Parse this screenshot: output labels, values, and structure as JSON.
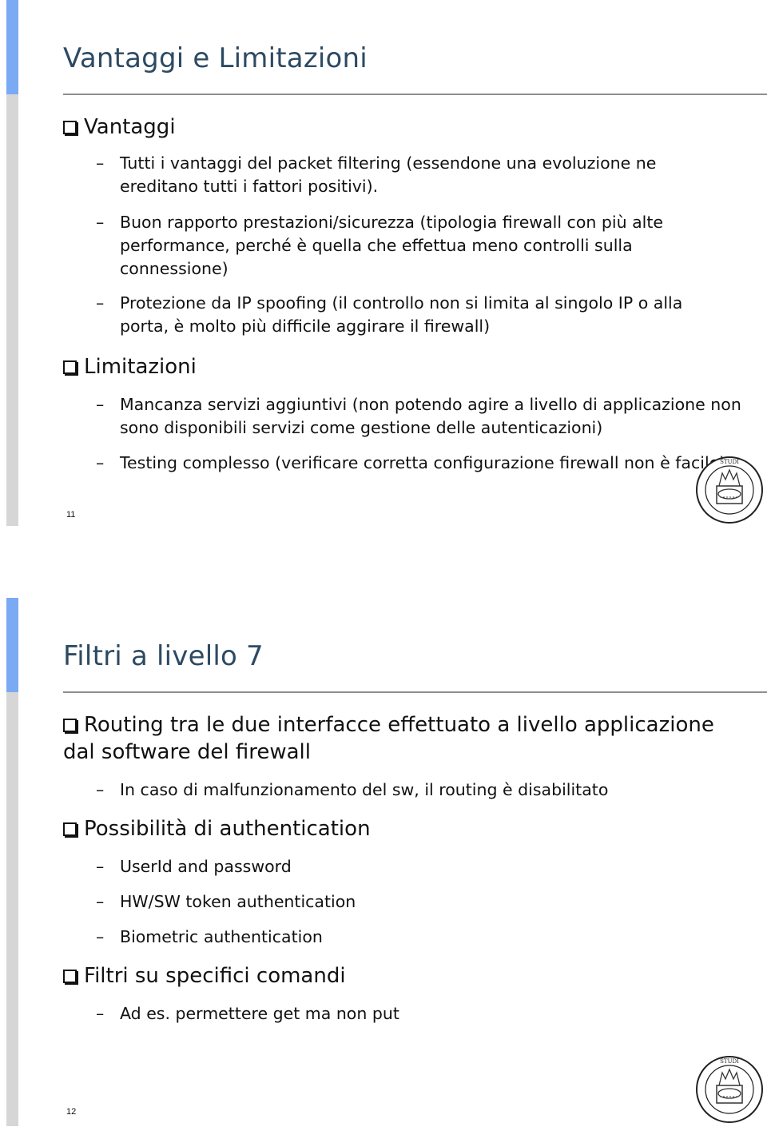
{
  "slides": [
    {
      "title": "Vantaggi e Limitazioni",
      "page_number": "11",
      "sections": [
        {
          "heading": "Vantaggi",
          "items": [
            "Tutti i vantaggi del packet filtering (essendone una evoluzione ne ereditano tutti i fattori positivi).",
            "Buon rapporto prestazioni/sicurezza (tipologia firewall con più alte performance, perché è quella che effettua meno controlli sulla connessione)",
            "Protezione da IP spoofing (il controllo non si limita al singolo IP o alla porta, è molto più difficile aggirare il firewall)"
          ]
        },
        {
          "heading": "Limitazioni",
          "items": [
            "Mancanza servizi aggiuntivi (non potendo agire a livello di applicazione non sono disponibili servizi come gestione delle autenticazioni)",
            "Testing complesso (verificare corretta configurazione firewall non è facile)"
          ]
        }
      ],
      "logo_icon": "university-seal-icon",
      "logo_text": "UNIVERSITAS · STUDI · VERONA"
    },
    {
      "title": "Filtri a livello 7",
      "page_number": "12",
      "sections": [
        {
          "heading": "Routing tra le due interfacce effettuato a livello applicazione dal software del firewall",
          "items": [
            "In caso di malfunzionamento del sw, il routing è disabilitato"
          ]
        },
        {
          "heading": "Possibilità di authentication",
          "items": [
            "UserId and password",
            "HW/SW token authentication",
            "Biometric authentication"
          ]
        },
        {
          "heading": "Filtri su specifici comandi",
          "items": [
            "Ad es. permettere get ma non put"
          ]
        }
      ],
      "logo_icon": "university-seal-icon",
      "logo_text": "UNIVERSITAS · STUDI · VERONA"
    }
  ],
  "bullet_icon": "checkbox-square-icon",
  "dash": "–",
  "colors": {
    "title": "#2d4a63",
    "accent_bar": "#7aaaf4",
    "side_bar": "#d6d6d6",
    "rule": "#8c8f92"
  }
}
